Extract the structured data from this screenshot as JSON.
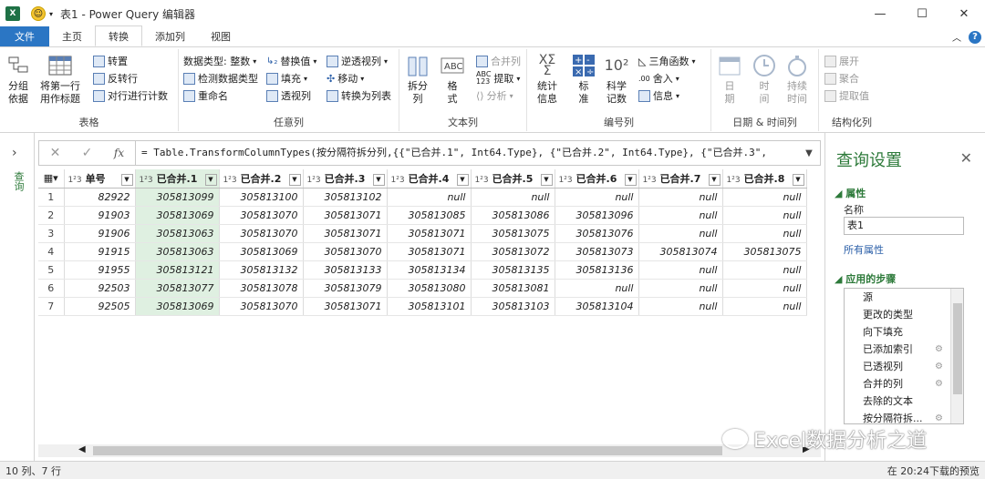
{
  "window": {
    "title": "表1 - Power Query 编辑器",
    "app_icon": "X"
  },
  "tabs": [
    "文件",
    "主页",
    "转换",
    "添加列",
    "视图"
  ],
  "ribbon": {
    "table_group": {
      "label": "表格",
      "group_by": "分组\n依据",
      "first_row_header": "将第一行\n用作标题",
      "transpose": "转置",
      "reverse": "反转行",
      "count_rows": "对行进行计数"
    },
    "any_column_group": {
      "label": "任意列",
      "data_type": "数据类型: 整数",
      "detect_type": "检测数据类型",
      "rename": "重命名",
      "replace": "替换值",
      "fill": "填充",
      "pivot": "透视列",
      "unpivot": "逆透视列",
      "move": "移动",
      "to_list": "转换为列表"
    },
    "text_column_group": {
      "label": "文本列",
      "split": "拆分\n列",
      "format": "格\n式",
      "merge": "合并列",
      "extract": "提取",
      "parse": "分析"
    },
    "number_column_group": {
      "label": "编号列",
      "stats": "统计\n信息",
      "standard": "标\n准",
      "scientific": "科学\n记数",
      "trig": "三角函数",
      "round": "舍入",
      "info": "信息"
    },
    "datetime_group": {
      "label": "日期 & 时间列",
      "date": "日\n期",
      "time": "时\n间",
      "duration": "持续\n时间"
    },
    "structured_group": {
      "label": "结构化列",
      "expand": "展开",
      "aggregate": "聚合",
      "extract_values": "提取值"
    }
  },
  "formula": "= Table.TransformColumnTypes(按分隔符拆分列,{{\"已合并.1\", Int64.Type}, {\"已合并.2\", Int64.Type}, {\"已合并.3\",",
  "left_pane": {
    "label": "查询"
  },
  "table": {
    "columns": [
      "单号",
      "已合并.1",
      "已合并.2",
      "已合并.3",
      "已合并.4",
      "已合并.5",
      "已合并.6",
      "已合并.7",
      "已合并.8"
    ],
    "type_glyph": "1²3",
    "rows": [
      [
        "1",
        "82922",
        "305813099",
        "305813100",
        "305813102",
        "null",
        "null",
        "null",
        "null",
        "null"
      ],
      [
        "2",
        "91903",
        "305813069",
        "305813070",
        "305813071",
        "305813085",
        "305813086",
        "305813096",
        "null",
        "null"
      ],
      [
        "3",
        "91906",
        "305813063",
        "305813070",
        "305813071",
        "305813071",
        "305813075",
        "305813076",
        "null",
        "null"
      ],
      [
        "4",
        "91915",
        "305813063",
        "305813069",
        "305813070",
        "305813071",
        "305813072",
        "305813073",
        "305813074",
        "305813075"
      ],
      [
        "5",
        "91955",
        "305813121",
        "305813132",
        "305813133",
        "305813134",
        "305813135",
        "305813136",
        "null",
        "null"
      ],
      [
        "6",
        "92503",
        "305813077",
        "305813078",
        "305813079",
        "305813080",
        "305813081",
        "null",
        "null",
        "null"
      ],
      [
        "7",
        "92505",
        "305813069",
        "305813070",
        "305813071",
        "305813101",
        "305813103",
        "305813104",
        "null",
        "null"
      ]
    ]
  },
  "status": {
    "left": "10 列、7 行",
    "right": "在 20:24下载的预览"
  },
  "query_settings": {
    "title": "查询设置",
    "properties_label": "属性",
    "name_label": "名称",
    "name_value": "表1",
    "all_props": "所有属性",
    "steps_label": "应用的步骤",
    "steps": [
      "源",
      "更改的类型",
      "向下填充",
      "已添加索引",
      "已透视列",
      "合并的列",
      "去除的文本",
      "按分隔符拆..."
    ]
  },
  "watermark": "Excel数据分析之道"
}
